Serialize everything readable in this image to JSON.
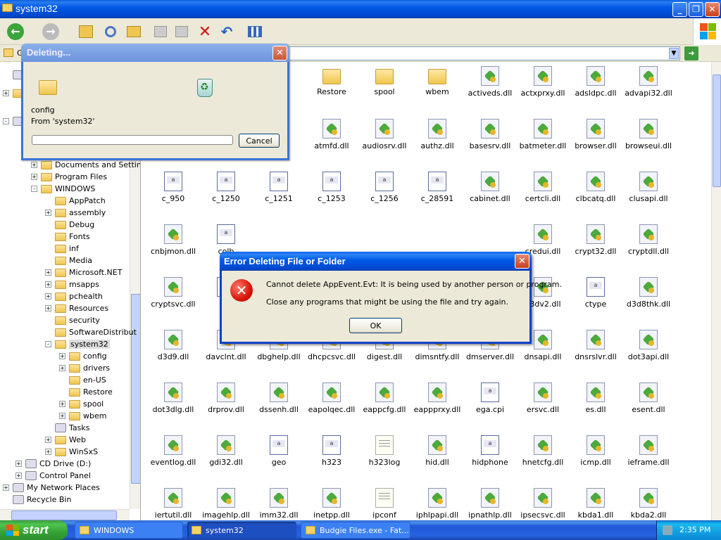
{
  "explorer": {
    "title": "system32",
    "address_prefix": "G"
  },
  "tree": {
    "items": [
      {
        "label": "D",
        "exp": "none",
        "icon": "spec",
        "level": 0
      },
      {
        "label": "",
        "exp": "+",
        "icon": "fold",
        "level": 0
      },
      {
        "label": "",
        "exp": "-",
        "icon": "spec",
        "level": 0
      },
      {
        "label": "Documents and Settin",
        "exp": "+",
        "icon": "fold",
        "level": 2
      },
      {
        "label": "Program Files",
        "exp": "+",
        "icon": "fold",
        "level": 2
      },
      {
        "label": "WINDOWS",
        "exp": "-",
        "icon": "fold",
        "level": 2
      },
      {
        "label": "AppPatch",
        "exp": "none",
        "icon": "fold",
        "level": 3
      },
      {
        "label": "assembly",
        "exp": "+",
        "icon": "fold",
        "level": 3
      },
      {
        "label": "Debug",
        "exp": "none",
        "icon": "fold",
        "level": 3
      },
      {
        "label": "Fonts",
        "exp": "none",
        "icon": "fold",
        "level": 3
      },
      {
        "label": "inf",
        "exp": "none",
        "icon": "fold",
        "level": 3
      },
      {
        "label": "Media",
        "exp": "none",
        "icon": "fold",
        "level": 3
      },
      {
        "label": "Microsoft.NET",
        "exp": "+",
        "icon": "fold",
        "level": 3
      },
      {
        "label": "msapps",
        "exp": "+",
        "icon": "fold",
        "level": 3
      },
      {
        "label": "pchealth",
        "exp": "+",
        "icon": "fold",
        "level": 3
      },
      {
        "label": "Resources",
        "exp": "+",
        "icon": "fold",
        "level": 3
      },
      {
        "label": "security",
        "exp": "none",
        "icon": "fold",
        "level": 3
      },
      {
        "label": "SoftwareDistribut",
        "exp": "none",
        "icon": "fold",
        "level": 3
      },
      {
        "label": "system32",
        "exp": "-",
        "icon": "fold",
        "level": 3,
        "sel": true
      },
      {
        "label": "config",
        "exp": "+",
        "icon": "fold",
        "level": 4
      },
      {
        "label": "drivers",
        "exp": "+",
        "icon": "fold",
        "level": 4
      },
      {
        "label": "en-US",
        "exp": "none",
        "icon": "fold",
        "level": 4
      },
      {
        "label": "Restore",
        "exp": "none",
        "icon": "fold",
        "level": 4
      },
      {
        "label": "spool",
        "exp": "+",
        "icon": "fold",
        "level": 4
      },
      {
        "label": "wbem",
        "exp": "+",
        "icon": "fold",
        "level": 4
      },
      {
        "label": "Tasks",
        "exp": "none",
        "icon": "spec",
        "level": 3
      },
      {
        "label": "Web",
        "exp": "+",
        "icon": "fold",
        "level": 3
      },
      {
        "label": "WinSxS",
        "exp": "+",
        "icon": "fold",
        "level": 3
      },
      {
        "label": "CD Drive (D:)",
        "exp": "+",
        "icon": "spec",
        "level": 1
      },
      {
        "label": "Control Panel",
        "exp": "+",
        "icon": "spec",
        "level": 1
      },
      {
        "label": "My Network Places",
        "exp": "+",
        "icon": "spec",
        "level": 0
      },
      {
        "label": "Recycle Bin",
        "exp": "none",
        "icon": "spec",
        "level": 0
      }
    ]
  },
  "files": [
    [
      "",
      "",
      "",
      "Restore",
      "spool",
      "wbem",
      "activeds.dll",
      "actxprxy.dll",
      "adsldpc.dll",
      "advapi32.dll"
    ],
    [
      "",
      "",
      "",
      "atmfd.dll",
      "audiosrv.dll",
      "authz.dll",
      "basesrv.dll",
      "batmeter.dll",
      "browser.dll",
      "browseui.dll"
    ],
    [
      "c_950",
      "c_1250",
      "c_1251",
      "c_1253",
      "c_1256",
      "c_28591",
      "cabinet.dll",
      "certcli.dll",
      "clbcatq.dll",
      "clusapi.dll"
    ],
    [
      "cnbjmon.dll",
      "colb",
      "",
      "",
      "",
      "",
      "",
      "credui.dll",
      "crypt32.dll",
      "cryptdll.dll"
    ],
    [
      "cryptsvc.dll",
      "cry",
      "",
      "",
      "",
      "",
      "",
      "d3dv2.dll",
      "ctype",
      "d3d8thk.dll"
    ],
    [
      "d3d9.dll",
      "davclnt.dll",
      "dbghelp.dll",
      "dhcpcsvc.dll",
      "digest.dll",
      "dimsntfy.dll",
      "dmserver.dll",
      "dnsapi.dll",
      "dnsrslvr.dll",
      "dot3api.dll"
    ],
    [
      "dot3dlg.dll",
      "drprov.dll",
      "dssenh.dll",
      "eapolqec.dll",
      "eappcfg.dll",
      "eappprxy.dll",
      "ega.cpi",
      "ersvc.dll",
      "es.dll",
      "esent.dll"
    ],
    [
      "eventlog.dll",
      "gdi32.dll",
      "geo",
      "h323",
      "h323log",
      "hid.dll",
      "hidphone",
      "hnetcfg.dll",
      "icmp.dll",
      "ieframe.dll"
    ],
    [
      "iertutil.dll",
      "imagehlp.dll",
      "imm32.dll",
      "inetpp.dll",
      "ipconf",
      "iphlpapi.dll",
      "ipnathlp.dll",
      "ipsecsvc.dll",
      "kbda1.dll",
      "kbda2.dll"
    ]
  ],
  "deleting": {
    "title": "Deleting...",
    "item": "config",
    "from": "From 'system32'",
    "progress": 0,
    "cancel_label": "Cancel"
  },
  "error": {
    "title": "Error Deleting File or Folder",
    "line1": "Cannot delete AppEvent.Evt: It is being used by another person or program.",
    "line2": "Close any programs that might be using the file and try again.",
    "ok_label": "OK"
  },
  "taskbar": {
    "start_label": "start",
    "tasks": [
      {
        "label": "WINDOWS",
        "state": "normal"
      },
      {
        "label": "system32",
        "state": "active"
      },
      {
        "label": "Budgie Files.exe - Fat...",
        "state": "normal"
      }
    ],
    "time": "2:35 PM"
  },
  "colors": {
    "titlebar": "#0058e6",
    "start": "#36a236",
    "error_icon": "#d8160a"
  }
}
